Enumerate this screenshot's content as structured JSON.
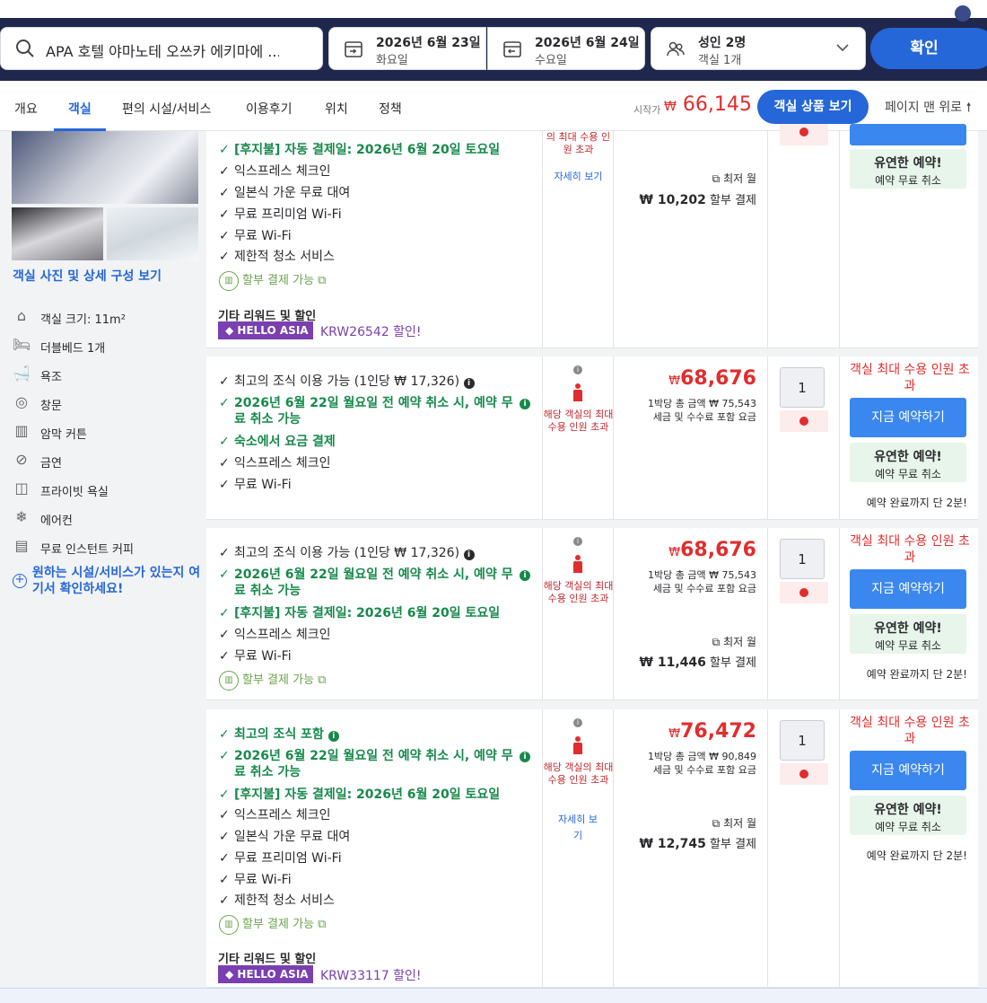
{
  "search": {
    "hotel": "APA 호텔 야마노테 오쓰카 에키마에 ...",
    "checkin_date": "2026년 6월 23일",
    "checkin_day": "화요일",
    "checkout_date": "2026년 6월 24일",
    "checkout_day": "수요일",
    "guests": "성인 2명",
    "rooms": "객실 1개",
    "confirm": "확인"
  },
  "nav": {
    "tabs": [
      "개요",
      "객실",
      "편의 시설/서비스",
      "이용후기",
      "위치",
      "정책"
    ],
    "from_label": "시작가",
    "currency": "₩",
    "from_price": "66,145",
    "view_button": "객실 상품 보기",
    "top_link": "페이지 맨 위로"
  },
  "left": {
    "room_link": "객실 사진 및 상세 구성 보기",
    "amenities": [
      "객실 크기: 11m²",
      "더블베드 1개",
      "욕조",
      "창문",
      "암막 커튼",
      "금연",
      "프라이빗 욕실",
      "에어컨",
      "무료 인스턴트 커피"
    ],
    "want_link": "원하는 시설/서비스가 있는지 여기서 확인하세요!"
  },
  "rows": [
    {
      "features": [
        {
          "text": "[후지불] 자동 결제일: 2026년 6월 20일 토요일",
          "green": true
        },
        {
          "text": "익스프레스 체크인",
          "green": false
        },
        {
          "text": "일본식 가운 무료 대여",
          "green": false
        },
        {
          "text": "무료 프리미엄 Wi-Fi",
          "green": false
        },
        {
          "text": "무료 Wi-Fi",
          "green": false
        },
        {
          "text": "제한적 청소 서비스",
          "green": false
        }
      ],
      "install": "할부 결제 가능",
      "reward_title": "기타 리워드 및 할인",
      "badge": "HELLO ASIA",
      "coupon": "KRW26542 할인!",
      "cap_partial": "의 최대 수용 인원 초과",
      "more": "자세히 보기",
      "min_label": "최저 월",
      "inst_amount": "₩ 10,202",
      "inst_label": "할부 결제",
      "flex_title": "유연한 예약!",
      "flex_sub": "예약 무료 취소"
    },
    {
      "features": [
        {
          "text": "최고의 조식 이용 가능 (1인당 ₩ 17,326)",
          "green": false
        },
        {
          "text": "2026년 6월 22일 월요일 전 예약 취소 시, 예약 무료 취소 가능",
          "green": true
        },
        {
          "text": "숙소에서 요금 결제",
          "green": true
        },
        {
          "text": "익스프레스 체크인",
          "green": false
        },
        {
          "text": "무료 Wi-Fi",
          "green": false
        }
      ],
      "cap": "해당 객실의 최대 수용 인원 초과",
      "price": "68,676",
      "total_line": "1박당 총 금액 ₩ 75,543",
      "tax_line": "세금 및 수수료 포함 요금",
      "qty": "1",
      "cap_red": "객실 최대 수용 인원 초과",
      "book": "지금 예약하기",
      "flex_title": "유연한 예약!",
      "flex_sub": "예약 무료 취소",
      "left_note": "예약 완료까지 단 2분!"
    },
    {
      "features": [
        {
          "text": "최고의 조식 이용 가능 (1인당 ₩ 17,326)",
          "green": false
        },
        {
          "text": "2026년 6월 22일 월요일 전 예약 취소 시, 예약 무료 취소 가능",
          "green": true
        },
        {
          "text": "[후지불] 자동 결제일: 2026년 6월 20일 토요일",
          "green": true
        },
        {
          "text": "익스프레스 체크인",
          "green": false
        },
        {
          "text": "무료 Wi-Fi",
          "green": false
        }
      ],
      "install": "할부 결제 가능",
      "cap": "해당 객실의 최대 수용 인원 초과",
      "price": "68,676",
      "total_line": "1박당 총 금액 ₩ 75,543",
      "tax_line": "세금 및 수수료 포함 요금",
      "min_label": "최저 월",
      "inst_amount": "₩ 11,446",
      "inst_label": "할부 결제",
      "qty": "1",
      "cap_red": "객실 최대 수용 인원 초과",
      "book": "지금 예약하기",
      "flex_title": "유연한 예약!",
      "flex_sub": "예약 무료 취소",
      "left_note": "예약 완료까지 단 2분!"
    },
    {
      "features": [
        {
          "text": "최고의 조식 포함",
          "green": true
        },
        {
          "text": "2026년 6월 22일 월요일 전 예약 취소 시, 예약 무료 취소 가능",
          "green": true
        },
        {
          "text": "[후지불] 자동 결제일: 2026년 6월 20일 토요일",
          "green": true
        },
        {
          "text": "익스프레스 체크인",
          "green": false
        },
        {
          "text": "일본식 가운 무료 대여",
          "green": false
        },
        {
          "text": "무료 프리미엄 Wi-Fi",
          "green": false
        },
        {
          "text": "무료 Wi-Fi",
          "green": false
        },
        {
          "text": "제한적 청소 서비스",
          "green": false
        }
      ],
      "install": "할부 결제 가능",
      "reward_title": "기타 리워드 및 할인",
      "badge": "HELLO ASIA",
      "coupon": "KRW33117 할인!",
      "cap": "해당 객실의 최대 수용 인원 초과",
      "more": "자세히 보기",
      "price": "76,472",
      "total_line": "1박당 총 금액 ₩ 90,849",
      "tax_line": "세금 및 수수료 포함 요금",
      "min_label": "최저 월",
      "inst_amount": "₩ 12,745",
      "inst_label": "할부 결제",
      "qty": "1",
      "cap_red": "객실 최대 수용 인원 초과",
      "book": "지금 예약하기",
      "flex_title": "유연한 예약!",
      "flex_sub": "예약 무료 취소",
      "left_note": "예약 완료까지 단 2분!"
    }
  ],
  "colors": {
    "brand_blue": "#2567d8",
    "price_red": "#e12d2d",
    "green": "#17894b",
    "navy": "#20274d",
    "promo_purple": "#7a3fb0"
  }
}
